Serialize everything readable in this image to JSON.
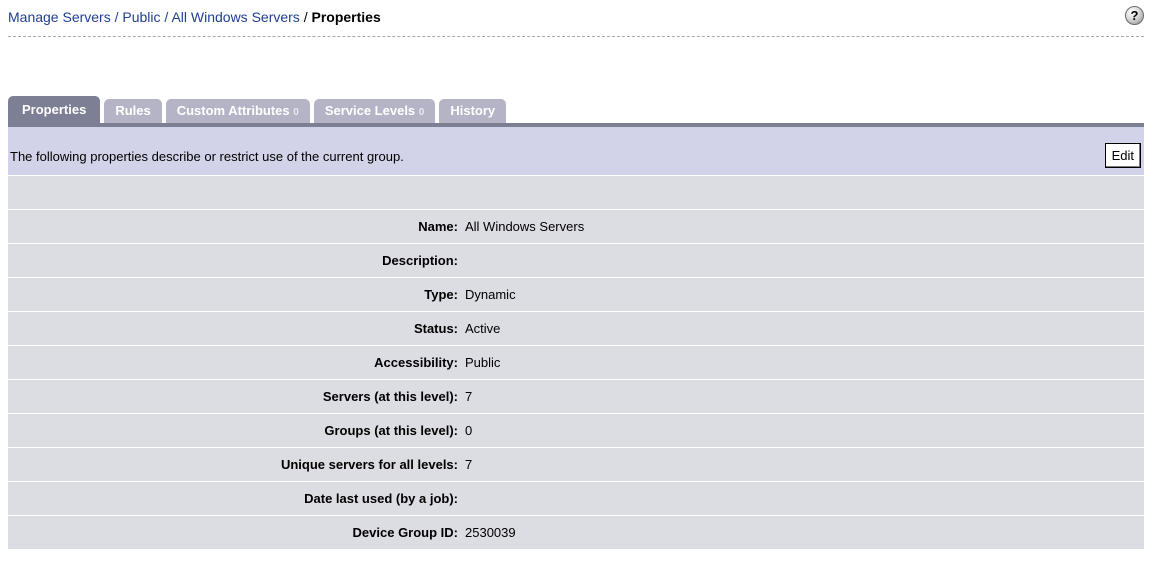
{
  "breadcrumb": {
    "items": [
      "Manage Servers",
      "Public",
      "All Windows Servers"
    ],
    "separator": "/",
    "current": "Properties"
  },
  "help": {
    "icon": "help-icon",
    "symbol": "?"
  },
  "tabs": [
    {
      "label": "Properties",
      "count": "",
      "active": true
    },
    {
      "label": "Rules",
      "count": "",
      "active": false
    },
    {
      "label": "Custom Attributes",
      "count": "0",
      "active": false
    },
    {
      "label": "Service Levels",
      "count": "0",
      "active": false
    },
    {
      "label": "History",
      "count": "",
      "active": false
    }
  ],
  "panel": {
    "description": "The following properties describe or restrict use of the current group.",
    "edit_label": "Edit"
  },
  "properties": [
    {
      "label": "Name:",
      "value": "All Windows Servers"
    },
    {
      "label": "Description:",
      "value": ""
    },
    {
      "label": "Type:",
      "value": "Dynamic"
    },
    {
      "label": "Status:",
      "value": "Active"
    },
    {
      "label": "Accessibility:",
      "value": "Public"
    },
    {
      "label": "Servers (at this level):",
      "value": "7"
    },
    {
      "label": "Groups (at this level):",
      "value": "0"
    },
    {
      "label": "Unique servers for all levels:",
      "value": "7"
    },
    {
      "label": "Date last used (by a job):",
      "value": ""
    },
    {
      "label": "Device Group ID:",
      "value": "2530039"
    }
  ],
  "colors": {
    "tab_active": "#7d7f95",
    "tab_inactive": "#b4b4c6",
    "description_bar": "#d2d2e8",
    "row_background": "#dcdce3",
    "link": "#1f3f8f"
  }
}
